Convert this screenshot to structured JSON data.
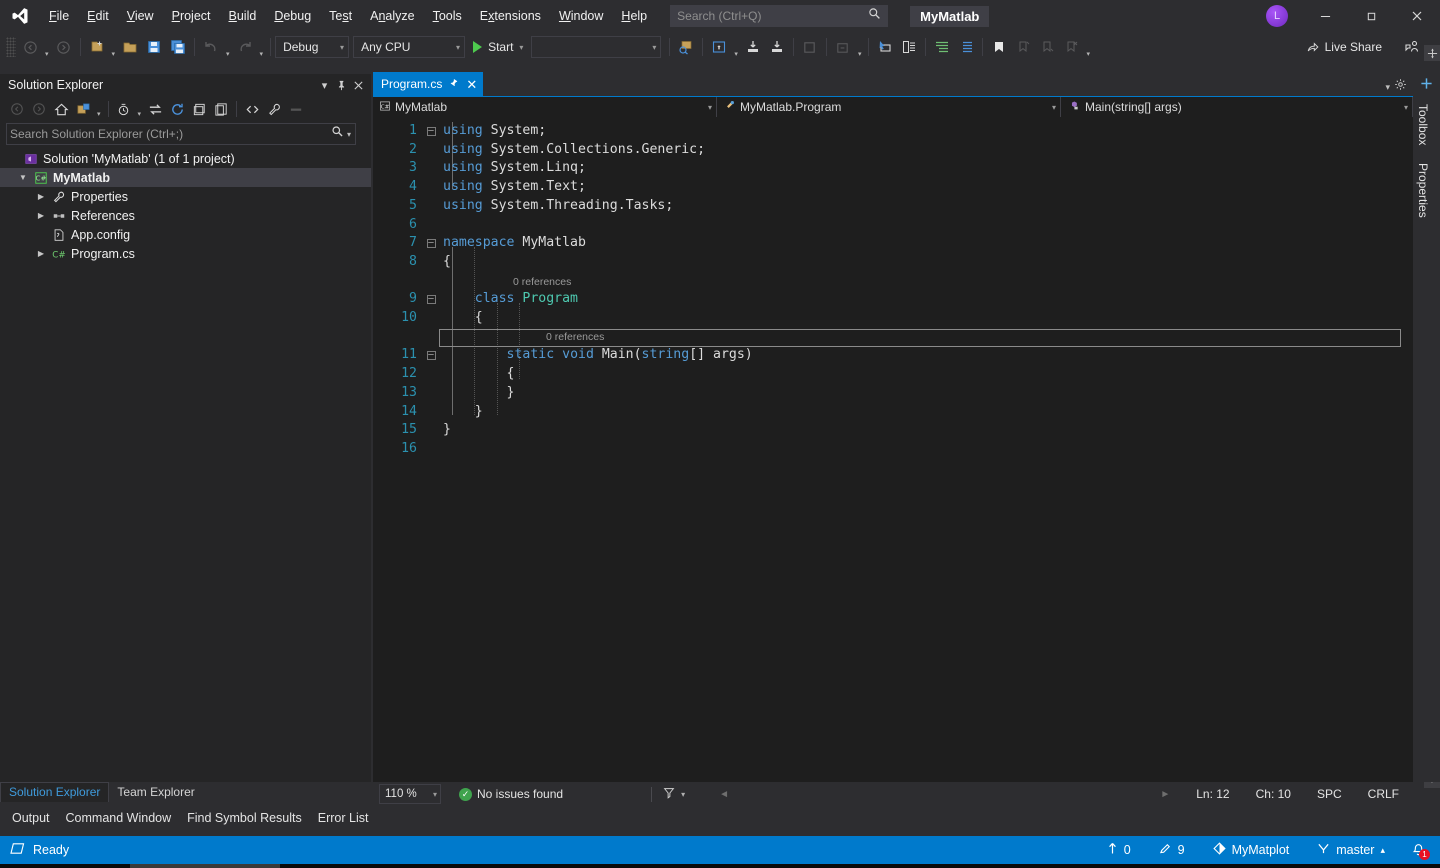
{
  "titlebar": {
    "logo_icon": "visual-studio-logo",
    "menu": [
      {
        "label": "File",
        "accel": "F"
      },
      {
        "label": "Edit",
        "accel": "E"
      },
      {
        "label": "View",
        "accel": "V"
      },
      {
        "label": "Project",
        "accel": "P"
      },
      {
        "label": "Build",
        "accel": "B"
      },
      {
        "label": "Debug",
        "accel": "D"
      },
      {
        "label": "Test",
        "accel": "T"
      },
      {
        "label": "Analyze",
        "accel": "n"
      },
      {
        "label": "Tools",
        "accel": "T"
      },
      {
        "label": "Extensions",
        "accel": "x"
      },
      {
        "label": "Window",
        "accel": "W"
      },
      {
        "label": "Help",
        "accel": "H"
      }
    ],
    "search_placeholder": "Search (Ctrl+Q)",
    "search_value": "",
    "project_name": "MyMatlab",
    "avatar_initial": "L",
    "minimize_label": "—",
    "maximize_label": "❐",
    "close_label": "✕"
  },
  "toolbar": {
    "back_icon": "navigate-back-icon",
    "forward_icon": "navigate-forward-icon",
    "new_project_icon": "new-project-icon",
    "open_file_icon": "open-file-icon",
    "save_icon": "save-icon",
    "save_all_icon": "save-all-icon",
    "undo_icon": "undo-icon",
    "redo_icon": "redo-icon",
    "config_value": "Debug",
    "platform_value": "Any CPU",
    "start_label": "Start",
    "start_icon": "play-icon",
    "process_value": "",
    "live_share_label": "Live Share",
    "live_share_icon": "live-share-icon",
    "share_icon": "share-session-icon",
    "attach_icon": "attach-process-icon",
    "screenshot_icon": "select-window-icon",
    "step_into_icon": "step-into-icon",
    "step_over_icon": "step-over-icon",
    "stop_icon": "stop-icon",
    "restart_icon": "restart-icon",
    "pointer_icon": "pointer-icon",
    "comment_icon": "comment-icon",
    "uncomment_icon": "uncomment-icon",
    "indent_icon": "increase-indent-icon",
    "outdent_icon": "decrease-indent-icon",
    "bookmark_icon": "bookmark-icon",
    "prev_bookmark_icon": "previous-bookmark-icon",
    "next_bookmark_icon": "next-bookmark-icon",
    "clear_bookmark_icon": "clear-bookmarks-icon"
  },
  "solution_explorer": {
    "title": "Solution Explorer",
    "dropdown_icon": "chevron-down-icon",
    "pin_icon": "pin-icon",
    "close_icon": "close-icon",
    "toolbar_icons": [
      "back-icon",
      "forward-icon",
      "home-icon",
      "pending-changes-icon",
      "sync-with-active-document-icon",
      "refresh-icon",
      "collapse-all-icon",
      "show-all-files-icon",
      "view-code-icon",
      "properties-icon",
      "preview-selected-items-icon"
    ],
    "search_placeholder": "Search Solution Explorer (Ctrl+;)",
    "search_value": "",
    "tree": [
      {
        "label": "Solution 'MyMatlab' (1 of 1 project)",
        "indent": 0,
        "arrow": "",
        "icon": "solution-icon",
        "bold": false,
        "selected": false
      },
      {
        "label": "MyMatlab",
        "indent": 1,
        "arrow": "▼",
        "icon": "csharp-project-icon",
        "bold": true,
        "selected": true
      },
      {
        "label": "Properties",
        "indent": 2,
        "arrow": "▶",
        "icon": "wrench-icon",
        "bold": false,
        "selected": false
      },
      {
        "label": "References",
        "indent": 2,
        "arrow": "▶",
        "icon": "references-icon",
        "bold": false,
        "selected": false
      },
      {
        "label": "App.config",
        "indent": 2,
        "arrow": "",
        "icon": "config-file-icon",
        "bold": false,
        "selected": false
      },
      {
        "label": "Program.cs",
        "indent": 2,
        "arrow": "▶",
        "icon": "csharp-file-icon",
        "bold": false,
        "selected": false
      }
    ],
    "tabs": [
      {
        "label": "Solution Explorer",
        "active": true
      },
      {
        "label": "Team Explorer",
        "active": false
      }
    ]
  },
  "bottom_tool_tabs": [
    "Output",
    "Command Window",
    "Find Symbol Results",
    "Error List"
  ],
  "editor": {
    "tab_label": "Program.cs",
    "tab_pin_icon": "pin-icon",
    "tab_close_icon": "close-icon",
    "tabstrip_menu_icon": "chevron-down-icon",
    "tabstrip_settings_icon": "gear-icon",
    "nav_project": "MyMatlab",
    "nav_project_icon": "csharp-project-icon",
    "nav_type": "MyMatlab.Program",
    "nav_type_icon": "class-icon",
    "nav_member": "Main(string[] args)",
    "nav_member_icon": "method-private-icon",
    "lines": [
      {
        "n": 1,
        "glyph": "minus",
        "text": "using System;"
      },
      {
        "n": 2,
        "glyph": "",
        "text": "using System.Collections.Generic;"
      },
      {
        "n": 3,
        "glyph": "",
        "text": "using System.Linq;"
      },
      {
        "n": 4,
        "glyph": "",
        "text": "using System.Text;"
      },
      {
        "n": 5,
        "glyph": "",
        "text": "using System.Threading.Tasks;"
      },
      {
        "n": 6,
        "glyph": "",
        "text": ""
      },
      {
        "n": 7,
        "glyph": "minus",
        "text": "namespace MyMatlab"
      },
      {
        "n": 8,
        "glyph": "",
        "text": "{"
      },
      {
        "n": 9,
        "glyph": "minus",
        "text": "    class Program"
      },
      {
        "n": 10,
        "glyph": "",
        "text": "    {"
      },
      {
        "n": 11,
        "glyph": "minus",
        "text": "        static void Main(string[] args)"
      },
      {
        "n": 12,
        "glyph": "",
        "text": "        {"
      },
      {
        "n": 13,
        "glyph": "",
        "text": "        }"
      },
      {
        "n": 14,
        "glyph": "",
        "text": "    }"
      },
      {
        "n": 15,
        "glyph": "",
        "text": "}"
      },
      {
        "n": 16,
        "glyph": "",
        "text": ""
      }
    ],
    "codelens": [
      {
        "line": 9,
        "text": "0 references"
      },
      {
        "line": 11,
        "text": "0 references"
      }
    ],
    "current_line": 12,
    "scroll_up_icon": "scroll-up-icon",
    "scroll_down_icon": "scroll-down-icon",
    "split_icon": "split-editor-icon"
  },
  "editor_status": {
    "zoom_value": "110 %",
    "zoom_caret_icon": "chevron-down-icon",
    "issues_icon": "check-circle-icon",
    "issues_text": "No issues found",
    "filter_icon": "issue-filter-icon",
    "filter_caret_icon": "chevron-down-icon",
    "scroll_left_icon": "scroll-left-icon",
    "scroll_right_icon": "scroll-right-icon",
    "line_label": "Ln: 12",
    "char_label": "Ch: 10",
    "spaces_label": "SPC",
    "eol_label": "CRLF"
  },
  "right_tabs": [
    {
      "label": "Toolbox"
    },
    {
      "label": "Properties"
    }
  ],
  "right_tabs_add_icon": "add-panel-icon",
  "statusbar": {
    "ready_icon": "ready-icon",
    "ready_label": "Ready",
    "outgoing_icon": "up-arrow-icon",
    "outgoing_count": "0",
    "changes_icon": "pencil-icon",
    "changes_count": "9",
    "repo_icon": "source-control-icon",
    "repo_name": "MyMatplot",
    "branch_icon": "branch-icon",
    "branch_name": "master",
    "branch_caret_icon": "chevron-up-icon",
    "notification_icon": "bell-icon",
    "notification_count": "1"
  },
  "colors": {
    "accent_blue": "#007acc",
    "chrome": "#2d2d30",
    "panel": "#252526",
    "editor_bg": "#1e1e1e",
    "keyword": "#569cd6",
    "type": "#4ec9b0",
    "linenumber": "#2b91af",
    "text": "#dcdcdc",
    "error_red": "#e81123",
    "success_green": "#3fa34d"
  }
}
